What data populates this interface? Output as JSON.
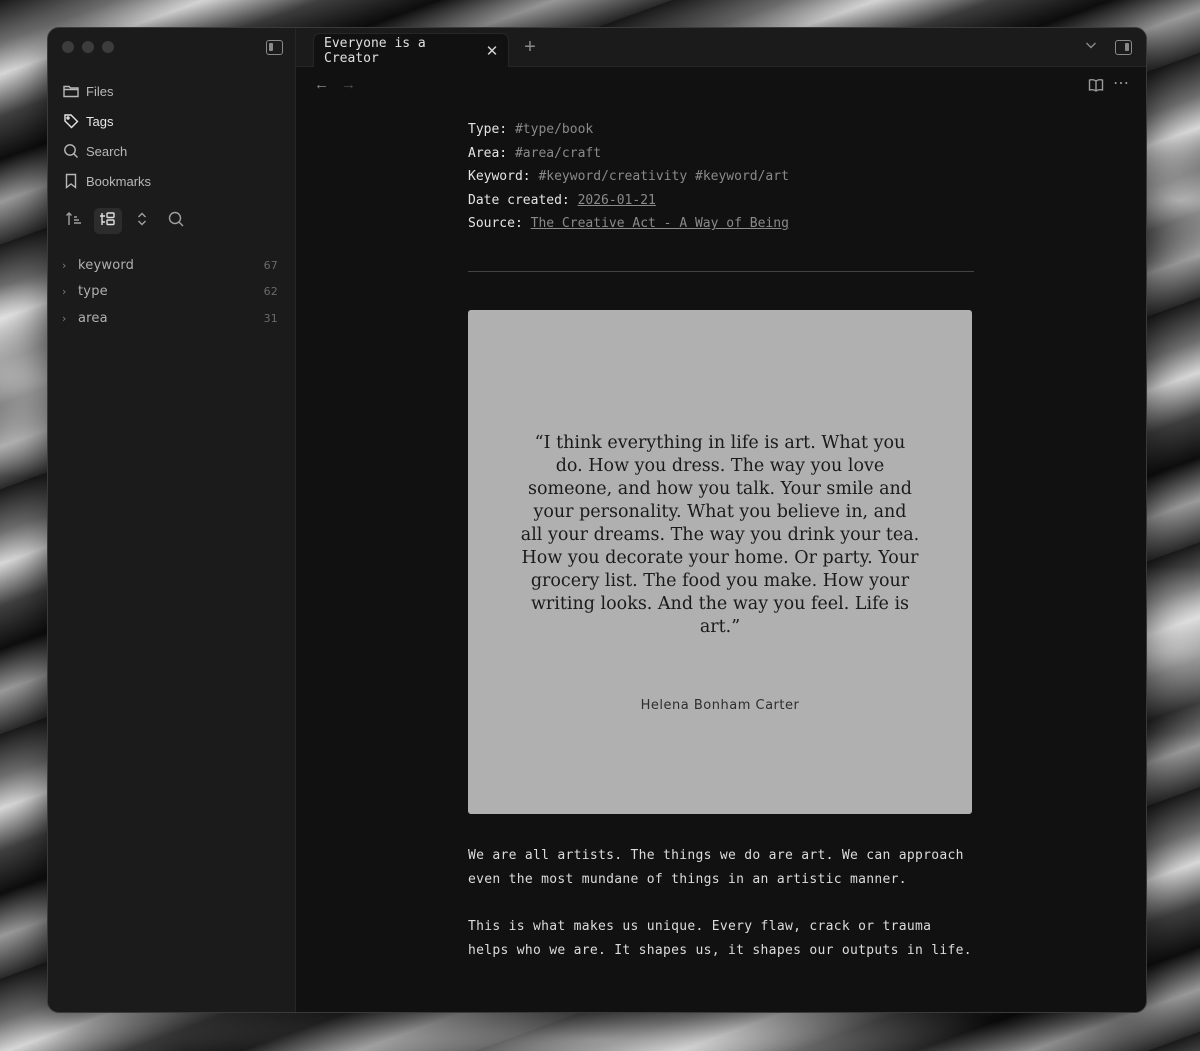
{
  "tab": {
    "title": "Everyone is a Creator"
  },
  "sidebar": {
    "nav": [
      {
        "label": "Files",
        "icon": "folder-icon"
      },
      {
        "label": "Tags",
        "icon": "tag-icon"
      },
      {
        "label": "Search",
        "icon": "search-icon"
      },
      {
        "label": "Bookmarks",
        "icon": "bookmark-icon"
      }
    ],
    "tags": [
      {
        "name": "keyword",
        "count": "67"
      },
      {
        "name": "type",
        "count": "62"
      },
      {
        "name": "area",
        "count": "31"
      }
    ]
  },
  "note": {
    "properties": {
      "type": {
        "key": "Type:",
        "value": "#type/book"
      },
      "area": {
        "key": "Area:",
        "value": "#area/craft"
      },
      "keyword": {
        "key": "Keyword:",
        "value": "#keyword/creativity #keyword/art"
      },
      "date": {
        "key": "Date created:",
        "value": "2026-01-21"
      },
      "source": {
        "key": "Source:",
        "value": "The Creative Act - A Way of Being"
      }
    },
    "quote": {
      "text": "“I think everything in life is art. What you do. How you dress. The way you love someone, and how you talk. Your smile and your personality. What you believe in, and all your dreams. The way you drink your tea. How you decorate your home. Or party. Your grocery list. The food you make. How your writing looks. And the way you feel. Life is art.”",
      "author": "Helena Bonham Carter"
    },
    "paragraphs": [
      "We are all artists. The things we do are art. We can approach even the most mundane of things in an artistic manner.",
      "This is what makes us unique. Every flaw, crack or trauma helps who we are. It shapes us, it shapes our outputs in life."
    ]
  }
}
